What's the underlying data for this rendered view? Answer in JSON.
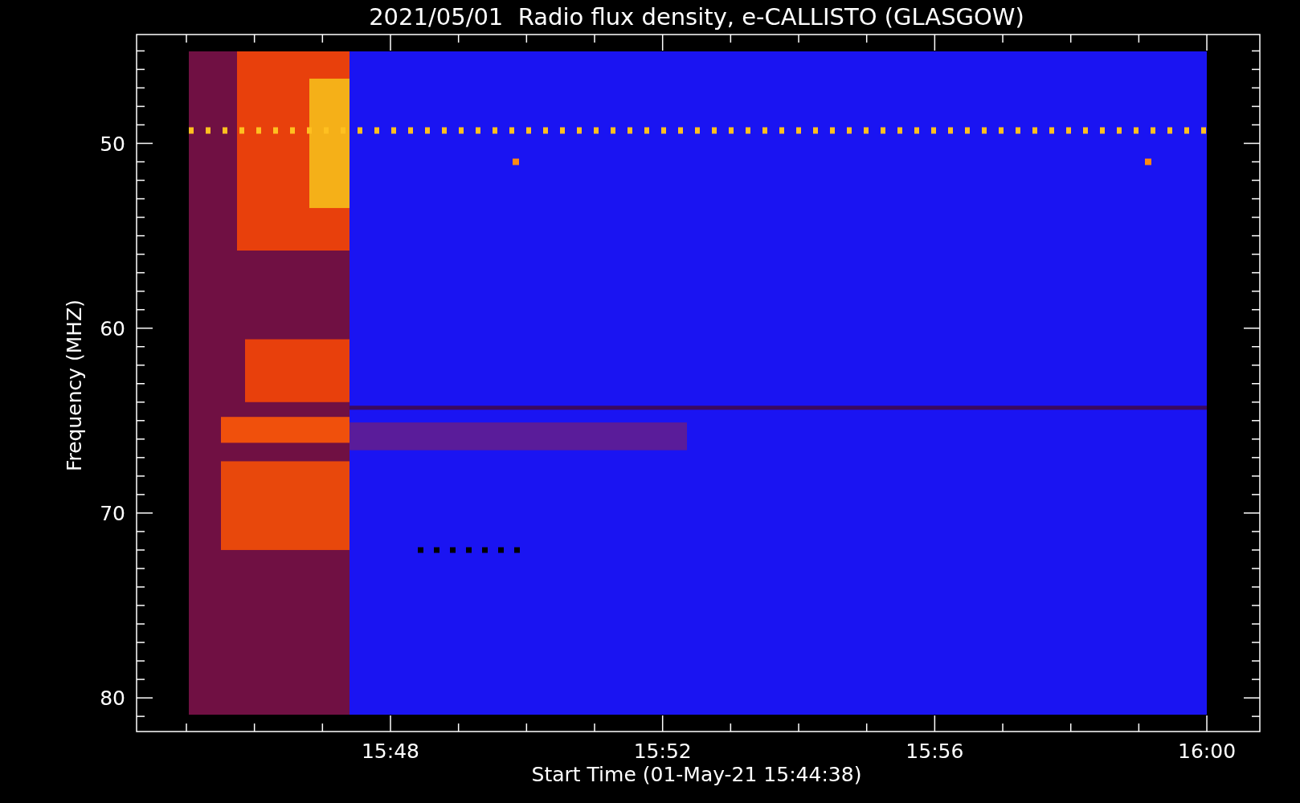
{
  "title": "2021/05/01  Radio flux density, e-CALLISTO (GLASGOW)",
  "y_axis": {
    "label": "Frequency (MHZ)",
    "tick_labels": [
      "50",
      "60",
      "70",
      "80"
    ]
  },
  "x_axis": {
    "label": "Start Time (01-May-21 15:44:38)",
    "tick_labels": [
      "15:48",
      "15:52",
      "15:56",
      "16:00"
    ]
  }
}
